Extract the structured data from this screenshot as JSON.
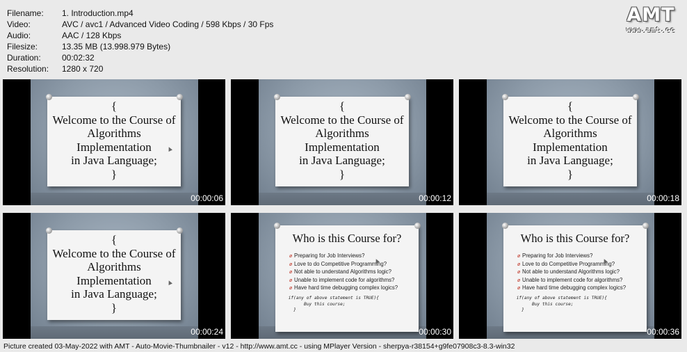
{
  "info": [
    {
      "key": "Filename:",
      "value": "1. Introduction.mp4"
    },
    {
      "key": "Video:",
      "value": "AVC / avc1 / Advanced Video Coding / 598 Kbps / 30 Fps"
    },
    {
      "key": "Audio:",
      "value": "AAC / 128 Kbps"
    },
    {
      "key": "Filesize:",
      "value": "13.35 MB (13.998.979 Bytes)"
    },
    {
      "key": "Duration:",
      "value": "00:02:32"
    },
    {
      "key": "Resolution:",
      "value": "1280 x 720"
    }
  ],
  "logo": {
    "big": "AMT",
    "small": "www.amt.cc"
  },
  "slide1": {
    "lines": [
      "{",
      "Welcome to the Course of",
      "Algorithms",
      "Implementation",
      "in Java Language;",
      "}"
    ]
  },
  "slide2": {
    "title": "Who is this Course for?",
    "bullet_glyph": "ø",
    "items": [
      "Preparing for Job Interviews?",
      "Love to do Competitive Programming?",
      "Not able to understand Algorithms logic?",
      "Unable to implement code for algorithms?",
      "Have hard time debugging complex logics?"
    ],
    "code": [
      "     if(any of above statement is TRUE){",
      "           Buy this course;",
      "       }"
    ]
  },
  "thumbnails": [
    {
      "timestamp": "00:00:06",
      "slide": "slide1"
    },
    {
      "timestamp": "00:00:12",
      "slide": "slide1"
    },
    {
      "timestamp": "00:00:18",
      "slide": "slide1"
    },
    {
      "timestamp": "00:00:24",
      "slide": "slide1"
    },
    {
      "timestamp": "00:00:30",
      "slide": "slide2"
    },
    {
      "timestamp": "00:00:36",
      "slide": "slide2"
    }
  ],
  "footer": "Picture created 03-May-2022 with AMT - Auto-Movie-Thumbnailer - v12 - http://www.amt.cc - using MPlayer Version - sherpya-r38154+g9fe07908c3-8.3-win32"
}
